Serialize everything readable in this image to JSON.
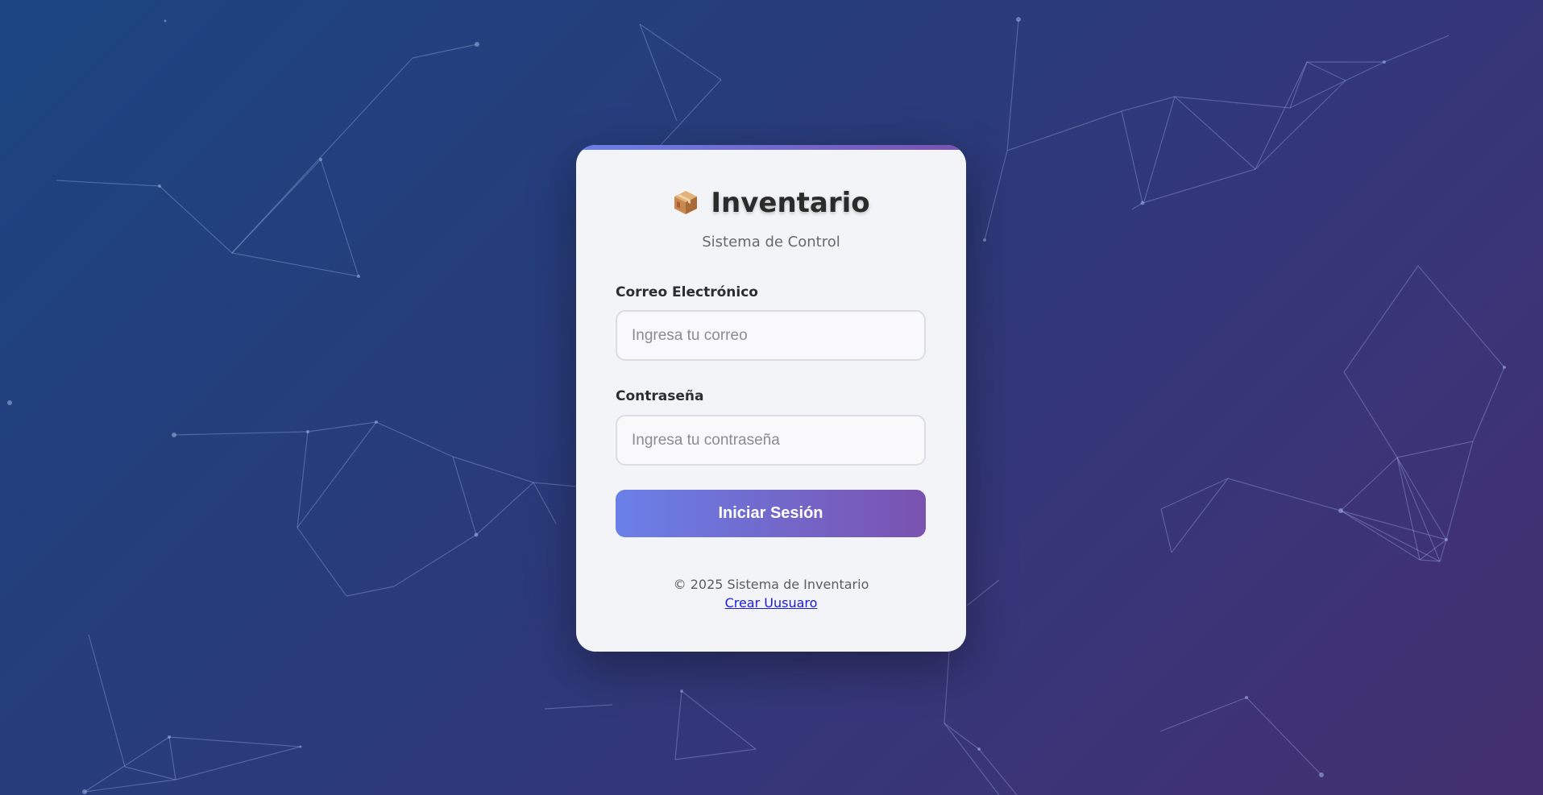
{
  "app": {
    "title": "Inventario",
    "subtitle": "Sistema de Control",
    "icon": "package-icon"
  },
  "form": {
    "email": {
      "label": "Correo Electrónico",
      "placeholder": "Ingresa tu correo",
      "value": ""
    },
    "password": {
      "label": "Contraseña",
      "placeholder": "Ingresa tu contraseña",
      "value": ""
    },
    "submit_label": "Iniciar Sesión"
  },
  "footer": {
    "copyright": "© 2025 Sistema de Inventario",
    "create_user_link": "Crear Uusuaro"
  },
  "colors": {
    "background_start": "#1b4580",
    "background_end": "#43306f",
    "card": "#f3f4f8",
    "accent_start": "#6a80e8",
    "accent_end": "#7a52b0",
    "link": "#1a1ae0"
  }
}
